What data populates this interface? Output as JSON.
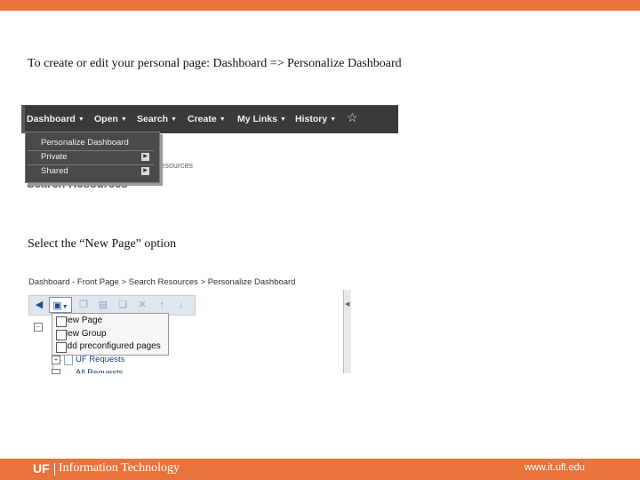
{
  "slide": {
    "instruction_1": "To create or edit your personal page:  Dashboard => Personalize Dashboard",
    "instruction_2": "Select the “New Page” option"
  },
  "menubar": {
    "items": [
      {
        "label": "Dashboard"
      },
      {
        "label": "Open"
      },
      {
        "label": "Search"
      },
      {
        "label": "Create"
      },
      {
        "label": "My Links"
      },
      {
        "label": "History"
      }
    ],
    "star_icon": "star-icon"
  },
  "dashboard_menu": {
    "items": [
      {
        "label": "Personalize Dashboard"
      },
      {
        "label": "Private"
      },
      {
        "label": "Shared"
      }
    ]
  },
  "background_page": {
    "small_text": "Resources",
    "heading": "Search Resources"
  },
  "screenshot2": {
    "breadcrumb": "Dashboard - Front Page > Search Resources > Personalize Dashboard",
    "context_menu": [
      {
        "label": "New Page"
      },
      {
        "label": "New Group"
      },
      {
        "label": "Add preconfigured pages"
      }
    ],
    "tree_items": [
      {
        "label": "UF Requests"
      },
      {
        "label": "All Requests"
      }
    ]
  },
  "footer": {
    "logo": "UF",
    "org": "Information Technology",
    "url": "www.it.ufl.edu"
  },
  "colors": {
    "accent": "#e8743b",
    "menubar": "#3a3a3a",
    "toolbar": "#dfe6ee"
  }
}
